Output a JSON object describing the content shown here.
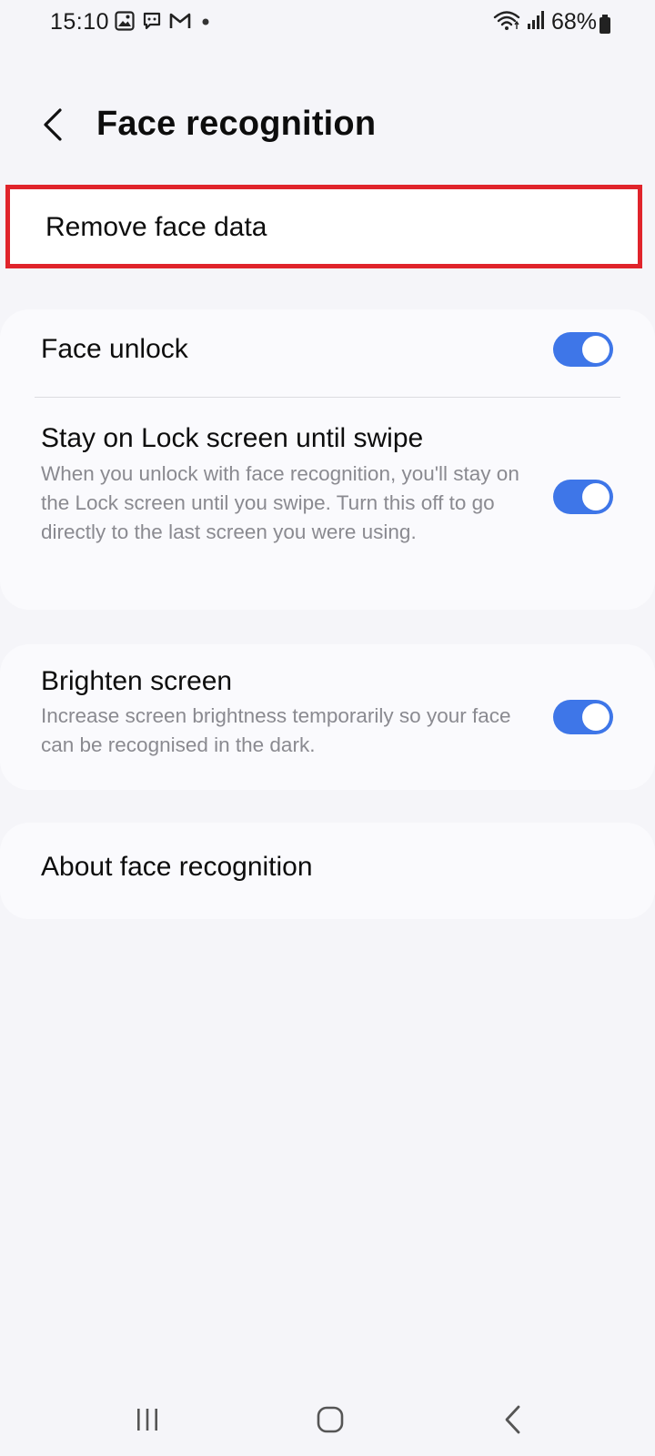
{
  "status_bar": {
    "time": "15:10",
    "battery": "68%",
    "notification_icons": [
      "gallery-icon",
      "chat-icon",
      "gmail-icon",
      "dot-icon"
    ],
    "right_icons": [
      "wifi-icon",
      "signal-icon",
      "battery-icon"
    ]
  },
  "header": {
    "title": "Face recognition"
  },
  "remove_face_data": {
    "label": "Remove face data"
  },
  "settings": {
    "face_unlock": {
      "title": "Face unlock",
      "enabled": true
    },
    "stay_on_lock": {
      "title": "Stay on Lock screen until swipe",
      "description": "When you unlock with face recognition, you'll stay on the Lock screen until you swipe. Turn this off to go directly to the last screen you were using.",
      "enabled": true
    },
    "brighten_screen": {
      "title": "Brighten screen",
      "description": "Increase screen brightness temporarily so your face can be recognised in the dark.",
      "enabled": true
    },
    "about": {
      "title": "About face recognition"
    }
  },
  "colors": {
    "toggle_on": "#3e76e8",
    "highlight_border": "#e0242b",
    "background": "#f5f5f9"
  },
  "nav_bar": {
    "icons": [
      "recent-apps-icon",
      "home-icon",
      "back-icon"
    ]
  }
}
